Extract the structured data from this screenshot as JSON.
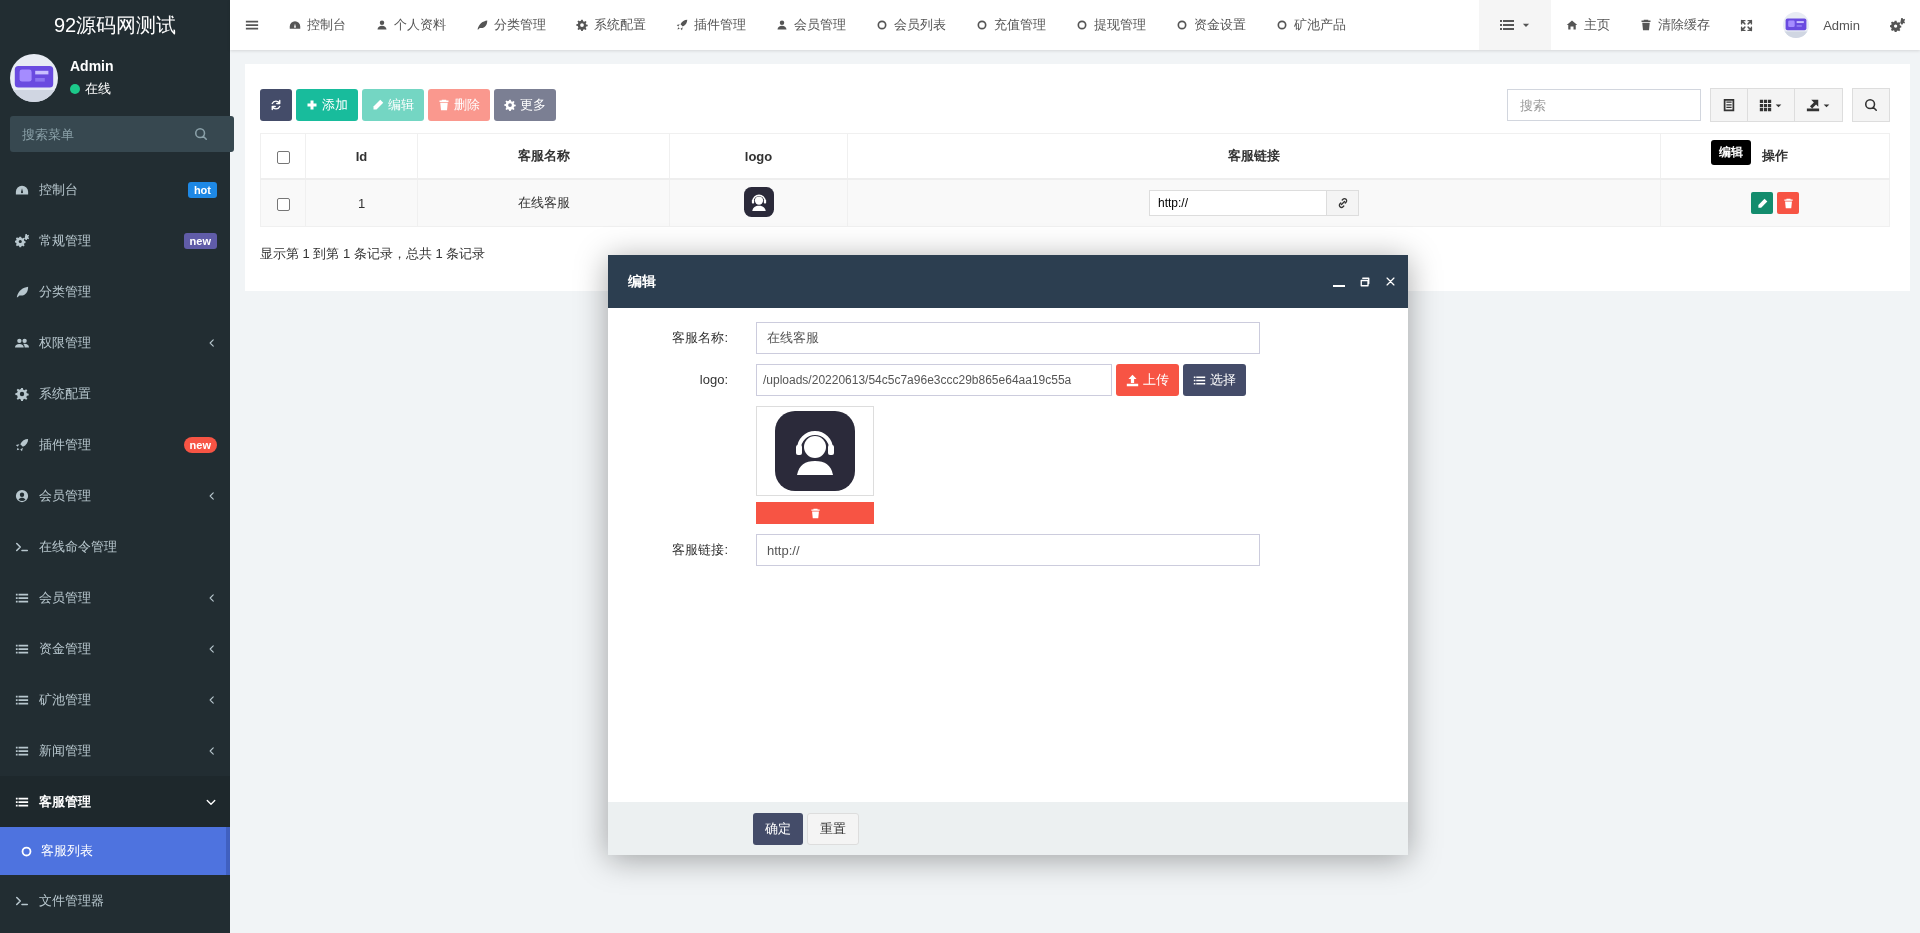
{
  "sidebar": {
    "title": "92源码网测试",
    "user": {
      "name": "Admin",
      "status": "在线",
      "online": true
    },
    "search": {
      "placeholder": "搜索菜单"
    },
    "items": [
      {
        "label": "控制台",
        "kind": "link",
        "selected": false,
        "badge": {
          "text": "hot",
          "color": "#1e88e5"
        }
      },
      {
        "label": "常规管理",
        "kind": "link",
        "selected": false,
        "badge": {
          "text": "new",
          "color": "#605ca8"
        }
      },
      {
        "label": "分类管理",
        "kind": "link",
        "selected": false
      },
      {
        "label": "权限管理",
        "kind": "menu",
        "selected": false,
        "expanded": false
      },
      {
        "label": "系统配置",
        "kind": "link",
        "selected": false
      },
      {
        "label": "插件管理",
        "kind": "link",
        "selected": false,
        "badge": {
          "text": "new",
          "color": "#f75444"
        }
      },
      {
        "label": "会员管理",
        "kind": "menu",
        "selected": false,
        "expanded": false
      },
      {
        "label": "在线命令管理",
        "kind": "link",
        "selected": false
      },
      {
        "label": "会员管理",
        "kind": "menu",
        "selected": false,
        "expanded": false
      },
      {
        "label": "资金管理",
        "kind": "menu",
        "selected": false,
        "expanded": false
      },
      {
        "label": "矿池管理",
        "kind": "menu",
        "selected": false,
        "expanded": false
      },
      {
        "label": "新闻管理",
        "kind": "menu",
        "selected": false,
        "expanded": false
      },
      {
        "label": "客服管理",
        "kind": "menu",
        "selected": false,
        "expanded": true,
        "children": [
          {
            "label": "客服列表",
            "selected": true
          }
        ]
      },
      {
        "label": "文件管理器",
        "kind": "link",
        "selected": false
      }
    ]
  },
  "topbar": {
    "nav": [
      {
        "label": "控制台"
      },
      {
        "label": "个人资料"
      },
      {
        "label": "分类管理"
      },
      {
        "label": "系统配置"
      },
      {
        "label": "插件管理"
      },
      {
        "label": "会员管理"
      },
      {
        "label": "会员列表"
      },
      {
        "label": "充值管理"
      },
      {
        "label": "提现管理"
      },
      {
        "label": "资金设置"
      },
      {
        "label": "矿池产品"
      }
    ],
    "home": "主页",
    "clear_cache": "清除缓存",
    "user": "Admin"
  },
  "toolbar": {
    "buttons": [
      {
        "kind": "refresh",
        "disabled": false
      },
      {
        "kind": "add",
        "label": "添加",
        "disabled": false
      },
      {
        "kind": "edit",
        "label": "编辑",
        "disabled": true
      },
      {
        "kind": "delete",
        "label": "删除",
        "disabled": true
      },
      {
        "kind": "more",
        "label": "更多",
        "disabled": false
      }
    ],
    "search": {
      "placeholder": "搜索"
    }
  },
  "table": {
    "header_checked": false,
    "columns": [
      "Id",
      "客服名称",
      "logo",
      "客服链接",
      "操作"
    ],
    "rows": [
      {
        "checked": false,
        "id": "1",
        "name": "在线客服",
        "link": "http://"
      }
    ],
    "tooltip": "编辑",
    "summary": "显示第 1 到第 1 条记录，总共 1 条记录"
  },
  "dialog": {
    "title": "编辑",
    "fields": [
      {
        "kind": "text",
        "label": "客服名称:",
        "value": "在线客服"
      },
      {
        "label": "logo:",
        "value": "/uploads/20220613/54c5c7a96e3ccc29b865e64aa19c55a",
        "upload": "上传",
        "choose": "选择"
      },
      {
        "kind": "text",
        "label": "客服链接:",
        "value": "http://"
      }
    ],
    "buttons": [
      {
        "kind": "primary",
        "label": "确定"
      },
      {
        "kind": "default",
        "label": "重置"
      }
    ]
  }
}
